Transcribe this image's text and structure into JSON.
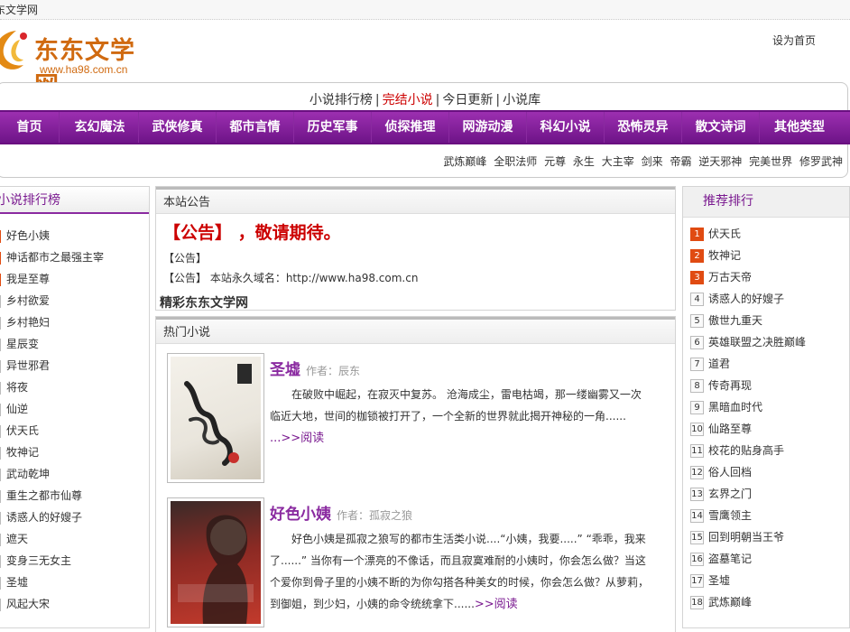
{
  "site": {
    "top_label": "东文学网",
    "logo_name": "东东文学网",
    "logo_url": "www.ha98.com.cn",
    "set_home": "设为首页"
  },
  "subnav": {
    "items": [
      "小说排行榜",
      "完结小说",
      "今日更新",
      "小说库"
    ],
    "separator": "|"
  },
  "mainnav": {
    "items": [
      "首页",
      "玄幻魔法",
      "武侠修真",
      "都市言情",
      "历史军事",
      "侦探推理",
      "网游动漫",
      "科幻小说",
      "恐怖灵异",
      "散文诗词",
      "其他类型"
    ]
  },
  "tags": [
    "武炼巅峰",
    "全职法师",
    "元尊",
    "永生",
    "大主宰",
    "剑来",
    "帝霸",
    "逆天邪神",
    "完美世界",
    "修罗武神"
  ],
  "left": {
    "title": "小说排行榜",
    "items": [
      "好色小姨",
      "神话都市之最强主宰",
      "我是至尊",
      "乡村欲爱",
      "乡村艳妇",
      "星辰变",
      "异世邪君",
      "将夜",
      "仙逆",
      "伏天氏",
      "牧神记",
      "武动乾坤",
      "重生之都市仙尊",
      "诱惑人的好嫂子",
      "遮天",
      "变身三无女主",
      "圣墟",
      "风起大宋"
    ]
  },
  "notice": {
    "title": "本站公告",
    "headline": "【公告】 ，敬请期待。",
    "line1": "【公告】",
    "line2": "【公告】 本站永久域名：http://www.ha98.com.cn",
    "site_name": "精彩东东文学网"
  },
  "hot": {
    "title": "热门小说",
    "books": [
      {
        "title": "圣墟",
        "author": "作者：辰东",
        "desc": "在破败中崛起，在寂灭中复苏。 沧海成尘，雷电枯竭，那一缕幽雾又一次临近大地，世间的枷锁被打开了，一个全新的世界就此揭开神秘的一角......",
        "read": "...>>阅读",
        "cover_text": "圣墟"
      },
      {
        "title": "好色小姨",
        "author": "作者：孤寂之狼",
        "desc": "好色小姨是孤寂之狼写的都市生活类小说....“小姨，我要.....” “乖乖，我来了......” 当你有一个漂亮的不像话，而且寂寞难耐的小姨时，你会怎么做？当这个爱你到骨子里的小姨不断的为你勾搭各种美女的时候，你会怎么做？从萝莉，到御姐，到少妇，小姨的命令统统拿下......",
        "read": ">>阅读",
        "cover_text": "好色小姨"
      }
    ]
  },
  "rank": {
    "title": "推荐排行",
    "items": [
      "伏天氏",
      "牧神记",
      "万古天帝",
      "诱惑人的好嫂子",
      "傲世九重天",
      "英雄联盟之决胜巅峰",
      "道君",
      "传奇再现",
      "黑暗血时代",
      "仙路至尊",
      "校花的贴身高手",
      "俗人回档",
      "玄界之门",
      "雪鹰领主",
      "回到明朝当王爷",
      "盗墓笔记",
      "圣墟",
      "武炼巅峰"
    ]
  },
  "colors": {
    "brand_purple": "#8a2aa0",
    "brand_orange": "#d06a10",
    "hot_red": "#e04b12",
    "notice_red": "#cc0000"
  }
}
